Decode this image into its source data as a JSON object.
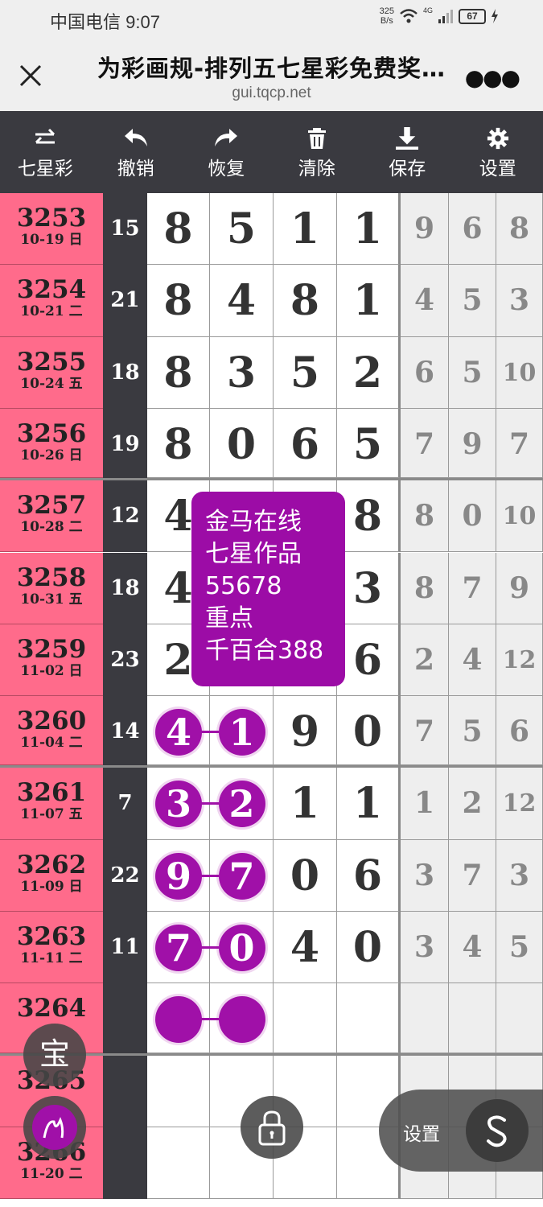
{
  "status_bar": {
    "carrier_time": "中国电信 9:07",
    "net_speed_value": "325",
    "net_speed_unit": "B/s",
    "signal": "4G",
    "battery": "67"
  },
  "title_bar": {
    "title": "为彩画规-排列五七星彩免费奖…",
    "url": "gui.tqcp.net"
  },
  "toolbar": [
    {
      "label": "七星彩",
      "icon": "swap-arrows-icon"
    },
    {
      "label": "撤销",
      "icon": "undo-icon"
    },
    {
      "label": "恢复",
      "icon": "redo-icon"
    },
    {
      "label": "清除",
      "icon": "trash-icon"
    },
    {
      "label": "保存",
      "icon": "download-icon"
    },
    {
      "label": "设置",
      "icon": "gear-icon"
    }
  ],
  "rows": [
    {
      "issue": "3253",
      "date": "10-19 日",
      "sum": "15",
      "main": [
        "8",
        "5",
        "1",
        "1"
      ],
      "side": [
        "9",
        "6",
        "8"
      ]
    },
    {
      "issue": "3254",
      "date": "10-21 二",
      "sum": "21",
      "main": [
        "8",
        "4",
        "8",
        "1"
      ],
      "side": [
        "4",
        "5",
        "3"
      ]
    },
    {
      "issue": "3255",
      "date": "10-24 五",
      "sum": "18",
      "main": [
        "8",
        "3",
        "5",
        "2"
      ],
      "side": [
        "6",
        "5",
        "10"
      ]
    },
    {
      "issue": "3256",
      "date": "10-26 日",
      "sum": "19",
      "main": [
        "8",
        "0",
        "6",
        "5"
      ],
      "side": [
        "7",
        "9",
        "7"
      ]
    },
    {
      "issue": "3257",
      "date": "10-28 二",
      "sum": "12",
      "main": [
        "4",
        "",
        "",
        "8"
      ],
      "side": [
        "8",
        "0",
        "10"
      ]
    },
    {
      "issue": "3258",
      "date": "10-31 五",
      "sum": "18",
      "main": [
        "4",
        "",
        "",
        "3"
      ],
      "side": [
        "8",
        "7",
        "9"
      ]
    },
    {
      "issue": "3259",
      "date": "11-02 日",
      "sum": "23",
      "main": [
        "2",
        "",
        "",
        "6"
      ],
      "side": [
        "2",
        "4",
        "12"
      ]
    },
    {
      "issue": "3260",
      "date": "11-04 二",
      "sum": "14",
      "main": [
        "4",
        "1",
        "9",
        "0"
      ],
      "side": [
        "7",
        "5",
        "6"
      ],
      "balls": true
    },
    {
      "issue": "3261",
      "date": "11-07 五",
      "sum": "7",
      "main": [
        "3",
        "2",
        "1",
        "1"
      ],
      "side": [
        "1",
        "2",
        "12"
      ],
      "balls": true
    },
    {
      "issue": "3262",
      "date": "11-09 日",
      "sum": "22",
      "main": [
        "9",
        "7",
        "0",
        "6"
      ],
      "side": [
        "3",
        "7",
        "3"
      ],
      "balls": true
    },
    {
      "issue": "3263",
      "date": "11-11 二",
      "sum": "11",
      "main": [
        "7",
        "0",
        "4",
        "0"
      ],
      "side": [
        "3",
        "4",
        "5"
      ],
      "balls": true
    },
    {
      "issue": "3264",
      "date": "",
      "sum": "",
      "main": [
        "",
        "",
        "",
        ""
      ],
      "side": [
        "",
        "",
        ""
      ],
      "balls": true
    },
    {
      "issue": "3265",
      "date": "",
      "sum": "",
      "main": [
        "",
        "",
        "",
        ""
      ],
      "side": [
        "",
        "",
        ""
      ]
    },
    {
      "issue": "3266",
      "date": "11-20 二",
      "sum": "",
      "main": [
        "",
        "",
        "",
        ""
      ],
      "side": [
        "",
        "",
        ""
      ]
    }
  ],
  "annotation": {
    "lines": [
      "金马在线",
      "七星作品",
      "55678",
      "重点",
      "千百合388"
    ]
  },
  "floating": {
    "bao_label": "宝",
    "settings_label": "设置"
  },
  "colors": {
    "issue_bg": "#ff6b8b",
    "toolbar_bg": "#3a3a40",
    "accent_purple": "#a010a8"
  }
}
